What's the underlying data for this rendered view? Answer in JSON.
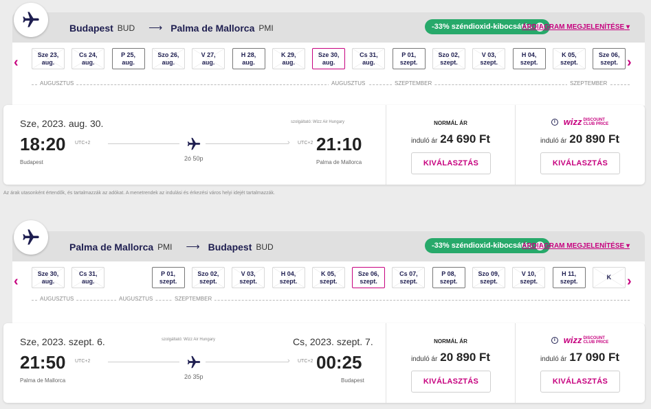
{
  "outbound": {
    "route": {
      "from_city": "Budapest",
      "from_code": "BUD",
      "arrow": "⟶",
      "to_city": "Palma de Mallorca",
      "to_code": "PMI"
    },
    "co2_badge": "-33% széndioxid-kibocsátás",
    "price_chart_link": "ÁRDIAGRAM MEGJELENÍTÉSE",
    "dates": [
      {
        "day": "Sze 23,",
        "month": "aug.",
        "status": "unavailable"
      },
      {
        "day": "Cs 24,",
        "month": "aug.",
        "status": "unavailable"
      },
      {
        "day": "P 25,",
        "month": "aug.",
        "status": "available"
      },
      {
        "day": "Szo 26,",
        "month": "aug.",
        "status": "unavailable"
      },
      {
        "day": "V 27,",
        "month": "aug.",
        "status": "unavailable"
      },
      {
        "day": "H 28,",
        "month": "aug.",
        "status": "available"
      },
      {
        "day": "K 29,",
        "month": "aug.",
        "status": "unavailable"
      },
      {
        "day": "Sze 30,",
        "month": "aug.",
        "status": "selected"
      },
      {
        "day": "Cs 31,",
        "month": "aug.",
        "status": "unavailable"
      },
      {
        "day": "P 01,",
        "month": "szept.",
        "status": "available"
      },
      {
        "day": "Szo 02,",
        "month": "szept.",
        "status": "unavailable"
      },
      {
        "day": "V 03,",
        "month": "szept.",
        "status": "unavailable"
      },
      {
        "day": "H 04,",
        "month": "szept.",
        "status": "available"
      },
      {
        "day": "K 05,",
        "month": "szept.",
        "status": "unavailable"
      },
      {
        "day": "Sze 06,",
        "month": "szept.",
        "status": "available"
      }
    ],
    "month_labels": [
      "AUGUSZTUS",
      "AUGUSZTUS",
      "SZEPTEMBER",
      "SZEPTEMBER"
    ],
    "flight": {
      "date": "Sze, 2023. aug. 30.",
      "dep_time": "18:20",
      "dep_utc": "UTC+2",
      "dep_city": "Budapest",
      "arr_date": "",
      "arr_time": "21:10",
      "arr_utc": "UTC+2",
      "arr_city": "Palma de Mallorca",
      "operator": "szolgáltató: Wizz Air Hungary",
      "duration": "2ó 50p"
    },
    "fares": {
      "normal_head": "NORMÁL ÁR",
      "from_label": "induló ár",
      "normal_price": "24 690 Ft",
      "club_price": "20 890 Ft",
      "select_label": "KIVÁLASZTÁS"
    }
  },
  "return": {
    "route": {
      "from_city": "Palma de Mallorca",
      "from_code": "PMI",
      "arrow": "⟶",
      "to_city": "Budapest",
      "to_code": "BUD"
    },
    "co2_badge": "-33% széndioxid-kibocsátás",
    "price_chart_link": "ÁRDIAGRAM MEGJELENÍTÉSE",
    "dates": [
      {
        "day": "Sze 30,",
        "month": "aug.",
        "status": "unavailable"
      },
      {
        "day": "Cs 31,",
        "month": "aug.",
        "status": "unavailable"
      },
      {
        "day": "P 01,",
        "month": "szept.",
        "status": "available"
      },
      {
        "day": "Szo 02,",
        "month": "szept.",
        "status": "unavailable"
      },
      {
        "day": "V 03,",
        "month": "szept.",
        "status": "unavailable"
      },
      {
        "day": "H 04,",
        "month": "szept.",
        "status": "unavailable"
      },
      {
        "day": "K 05,",
        "month": "szept.",
        "status": "unavailable"
      },
      {
        "day": "Sze 06,",
        "month": "szept.",
        "status": "selected"
      },
      {
        "day": "Cs 07,",
        "month": "szept.",
        "status": "unavailable"
      },
      {
        "day": "P 08,",
        "month": "szept.",
        "status": "available"
      },
      {
        "day": "Szo 09,",
        "month": "szept.",
        "status": "unavailable"
      },
      {
        "day": "V 10,",
        "month": "szept.",
        "status": "unavailable"
      },
      {
        "day": "H 11,",
        "month": "szept.",
        "status": "available"
      },
      {
        "day": "K",
        "month": "",
        "status": "unavailable"
      }
    ],
    "month_labels": [
      "AUGUSZTUS",
      "AUGUSZTUS",
      "SZEPTEMBER"
    ],
    "flight": {
      "date": "Sze, 2023. szept. 6.",
      "dep_time": "21:50",
      "dep_utc": "UTC+2",
      "dep_city": "Palma de Mallorca",
      "arr_date": "Cs, 2023. szept. 7.",
      "arr_time": "00:25",
      "arr_utc": "UTC+2",
      "arr_city": "Budapest",
      "operator": "szolgáltató: Wizz Air Hungary",
      "duration": "2ó 35p"
    },
    "fares": {
      "normal_head": "NORMÁL ÁR",
      "from_label": "induló ár",
      "normal_price": "20 890 Ft",
      "club_price": "17 090 Ft",
      "select_label": "KIVÁLASZTÁS"
    }
  },
  "club_logo": {
    "word": "wizz",
    "line1": "DISCOUNT",
    "line2": "CLUB PRICE"
  },
  "nav": {
    "prev": "‹",
    "next": "›"
  },
  "disclaimer": "Az árak utasonként értendők, és tartalmazzák az adókat. A menetrendek az indulási és érkezési város helyi idejét tartalmazzák.",
  "colors": {
    "brand_magenta": "#c6007e",
    "brand_navy": "#1e1e50",
    "co2_green": "#27a96a"
  },
  "icons": {
    "plane": "airplane-icon",
    "info": "info-icon",
    "chevron": "chevron-down-icon"
  }
}
